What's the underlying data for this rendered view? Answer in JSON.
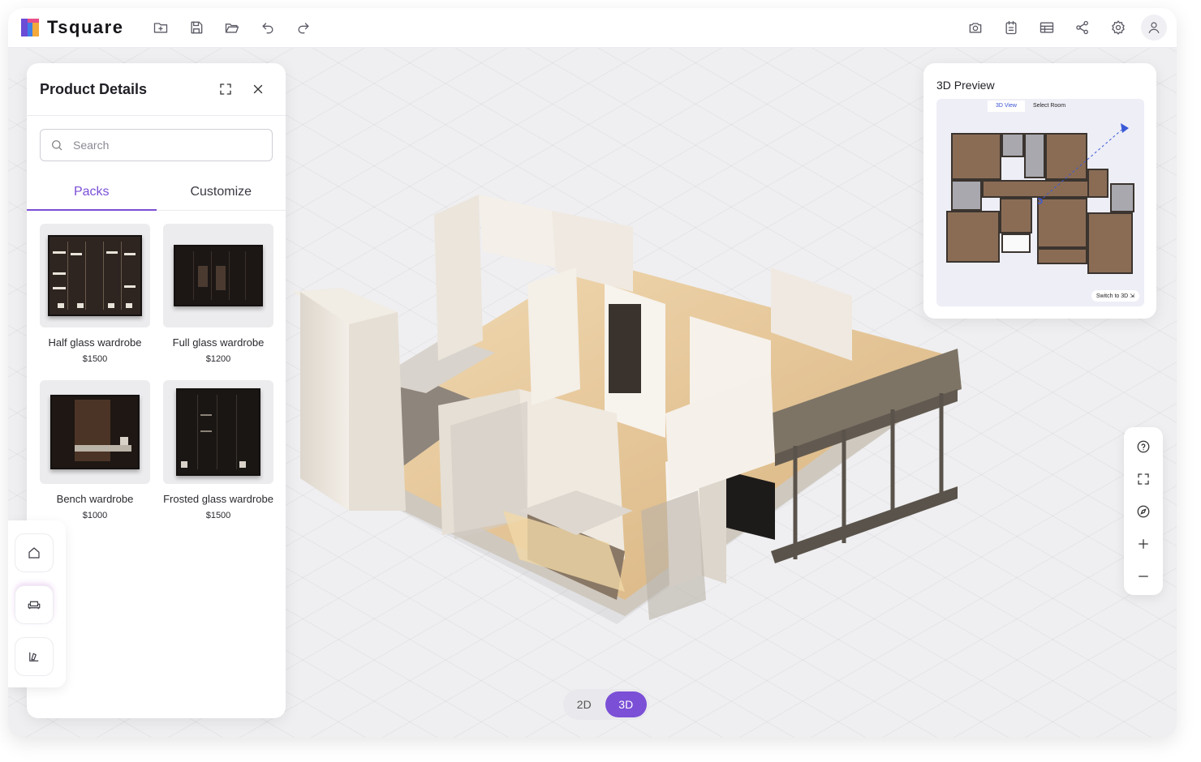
{
  "app": {
    "brand": "Tsquare"
  },
  "toolbar": {
    "left_icons": [
      "new-file-icon",
      "save-icon",
      "open-folder-icon",
      "undo-icon",
      "redo-icon"
    ],
    "right_icons": [
      "camera-icon",
      "clipboard-icon",
      "table-icon",
      "share-icon",
      "settings-icon",
      "user-icon"
    ]
  },
  "panel": {
    "title": "Product Details",
    "search_placeholder": "Search",
    "tabs": [
      {
        "label": "Packs",
        "active": true
      },
      {
        "label": "Customize",
        "active": false
      }
    ],
    "products": [
      {
        "name": "Half glass wardrobe",
        "price": "$1500"
      },
      {
        "name": "Full glass wardrobe",
        "price": "$1200"
      },
      {
        "name": "Bench wardrobe",
        "price": "$1000"
      },
      {
        "name": "Frosted glass wardrobe",
        "price": "$1500"
      }
    ]
  },
  "side_rail": [
    "home-icon",
    "sofa-icon",
    "paint-icon"
  ],
  "preview": {
    "title": "3D Preview",
    "tabs": [
      "3D View",
      "Select Room"
    ],
    "switch_label": "Switch to 3D"
  },
  "tools": [
    "help-icon",
    "fullscreen-icon",
    "compass-icon",
    "zoom-in-icon",
    "zoom-out-icon"
  ],
  "view_toggle": {
    "option_2d": "2D",
    "option_3d": "3D",
    "selected": "3D"
  },
  "colors": {
    "accent": "#7b4fd6",
    "wood": "#b38a5c",
    "wall": "#ece6dd"
  }
}
